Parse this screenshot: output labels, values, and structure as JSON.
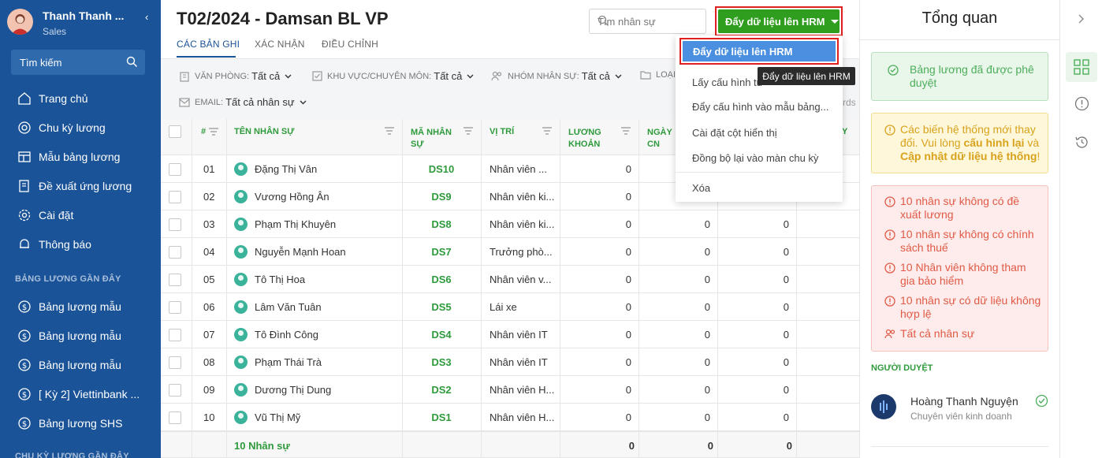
{
  "user": {
    "name": "Thanh Thanh ...",
    "role": "Sales"
  },
  "sidebar": {
    "search_label": "Tìm kiếm",
    "items": [
      {
        "label": "Trang chủ",
        "icon": "home-icon"
      },
      {
        "label": "Chu kỳ lương",
        "icon": "cycle-icon"
      },
      {
        "label": "Mẫu bảng lương",
        "icon": "table-template-icon"
      },
      {
        "label": "Đề xuất ứng lương",
        "icon": "document-icon"
      },
      {
        "label": "Cài đặt",
        "icon": "gear-icon"
      },
      {
        "label": "Thông báo",
        "icon": "bell-icon"
      }
    ],
    "recent_title": "BẢNG LƯƠNG GẦN ĐÂY",
    "recent_items": [
      "Bảng lương mẫu",
      "Bảng lương mẫu",
      "Bảng lương mẫu",
      "[ Kỳ 2] Viettinbank ...",
      "Bảng lương SHS"
    ],
    "recent_cycles_title": "CHU KỲ LƯƠNG GẦN ĐÂY"
  },
  "header": {
    "title": "T02/2024 - Damsan BL VP",
    "tabs": [
      "CÁC BẢN GHI",
      "XÁC NHẬN",
      "ĐIỀU CHỈNH"
    ],
    "search_placeholder": "Tìm nhân sự",
    "push_button": "Đẩy dữ liệu lên HRM"
  },
  "filters": [
    {
      "label": "VĂN PHÒNG:",
      "value": "Tất cả"
    },
    {
      "label": "KHU VỰC/CHUYÊN MÔN:",
      "value": "Tất cả"
    },
    {
      "label": "NHÓM NHÂN SỰ:",
      "value": "Tất cả"
    },
    {
      "label": "LOẠI",
      "value": ""
    },
    {
      "label": "EMAIL:",
      "value": "Tất cả nhân sự"
    }
  ],
  "records_partial": "rds",
  "dropdown": {
    "items": [
      "Đẩy dữ liệu lên HRM",
      "Lấy cấu hình từ",
      "Đẩy cấu hình vào mẫu bảng...",
      "Cài đặt cột hiển thị",
      "Đồng bộ lại vào màn chu kỳ",
      "Xóa"
    ],
    "tooltip": "Đẩy dữ liệu lên HRM"
  },
  "table": {
    "columns": [
      "#",
      "TÊN NHÂN SỰ",
      "MÃ NHÂN SỰ",
      "VỊ TRÍ",
      "LƯƠNG KHOẢN",
      "NGÀY CN",
      "Y"
    ],
    "rows": [
      {
        "no": "01",
        "name": "Đặng Thị Vân",
        "code": "DS10",
        "position": "Nhân viên ...",
        "salary": "0",
        "c1": "",
        "c2": ""
      },
      {
        "no": "02",
        "name": "Vương Hồng Ân",
        "code": "DS9",
        "position": "Nhân viên ki...",
        "salary": "0",
        "c1": "",
        "c2": ""
      },
      {
        "no": "03",
        "name": "Phạm Thị Khuyên",
        "code": "DS8",
        "position": "Nhân viên ki...",
        "salary": "0",
        "c1": "0",
        "c2": "0"
      },
      {
        "no": "04",
        "name": "Nguyễn Mạnh Hoan",
        "code": "DS7",
        "position": "Trưởng phò...",
        "salary": "0",
        "c1": "0",
        "c2": "0"
      },
      {
        "no": "05",
        "name": "Tô Thị Hoa",
        "code": "DS6",
        "position": "Nhân viên v...",
        "salary": "0",
        "c1": "0",
        "c2": "0"
      },
      {
        "no": "06",
        "name": "Lâm Văn Tuân",
        "code": "DS5",
        "position": "Lái xe",
        "salary": "0",
        "c1": "0",
        "c2": "0"
      },
      {
        "no": "07",
        "name": "Tô Đình Công",
        "code": "DS4",
        "position": "Nhân viên IT",
        "salary": "0",
        "c1": "0",
        "c2": "0"
      },
      {
        "no": "08",
        "name": "Phạm Thái Trà",
        "code": "DS3",
        "position": "Nhân viên IT",
        "salary": "0",
        "c1": "0",
        "c2": "0"
      },
      {
        "no": "09",
        "name": "Dương Thị Dung",
        "code": "DS2",
        "position": "Nhân viên H...",
        "salary": "0",
        "c1": "0",
        "c2": "0"
      },
      {
        "no": "10",
        "name": "Vũ Thị Mỹ",
        "code": "DS1",
        "position": "Nhân viên H...",
        "salary": "0",
        "c1": "0",
        "c2": "0"
      }
    ],
    "footer": {
      "count": "10 Nhân sự",
      "salary": "0",
      "c1": "0",
      "c2": "0"
    }
  },
  "panel": {
    "title": "Tổng quan",
    "approved": "Bảng lương đã được phê duyệt",
    "warning": {
      "pre": "Các biến hệ thống mới thay đổi. Vui lòng ",
      "link1": "cấu hình lại",
      "mid": " và ",
      "link2": "Cập nhật dữ liệu hệ thống",
      "post": "!"
    },
    "errors": [
      "10 nhân sự không có đề xuất lương",
      "10 nhân sự không có chính sách thuế",
      "10 Nhân viên không tham gia bảo hiểm",
      "10 nhân sự có dữ liệu không hợp lệ"
    ],
    "all_staff": "Tất cả nhân sự",
    "approver_label": "NGƯỜI DUYỆT",
    "approver_name": "Hoàng Thanh Nguyện",
    "approver_role": "Chuyên viên kinh doanh"
  },
  "colors": {
    "sidebar": "#1a5397",
    "accent_green": "#2f9e1f",
    "highlight_red": "#e01f1f",
    "menu_active": "#4a8fe0"
  }
}
